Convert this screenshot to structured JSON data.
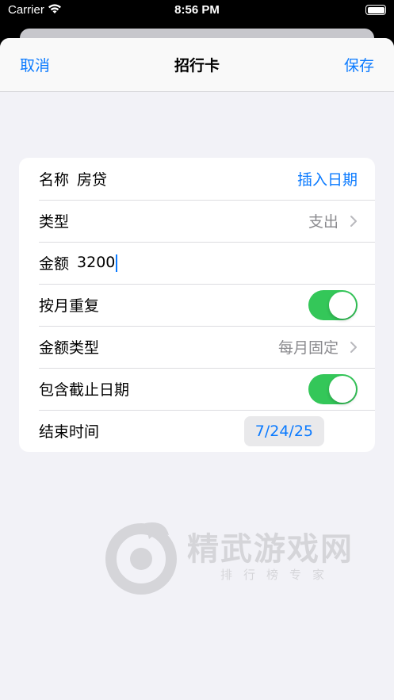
{
  "status_bar": {
    "carrier": "Carrier",
    "time": "8:56 PM"
  },
  "nav": {
    "cancel": "取消",
    "title": "招行卡",
    "save": "保存"
  },
  "form": {
    "name": {
      "label": "名称",
      "value": "房贷",
      "action": "插入日期"
    },
    "type": {
      "label": "类型",
      "value": "支出"
    },
    "amount": {
      "label": "金额",
      "value": "3200"
    },
    "repeat_monthly": {
      "label": "按月重复",
      "on": true
    },
    "amount_type": {
      "label": "金额类型",
      "value": "每月固定"
    },
    "include_end_date": {
      "label": "包含截止日期",
      "on": true
    },
    "end_time": {
      "label": "结束时间",
      "value": "7/24/25"
    }
  },
  "watermark": {
    "title": "精武游戏网",
    "subtitle": "排行榜专家"
  },
  "colors": {
    "accent": "#0a7aff",
    "toggle_on": "#34c759",
    "background": "#f2f2f7"
  }
}
